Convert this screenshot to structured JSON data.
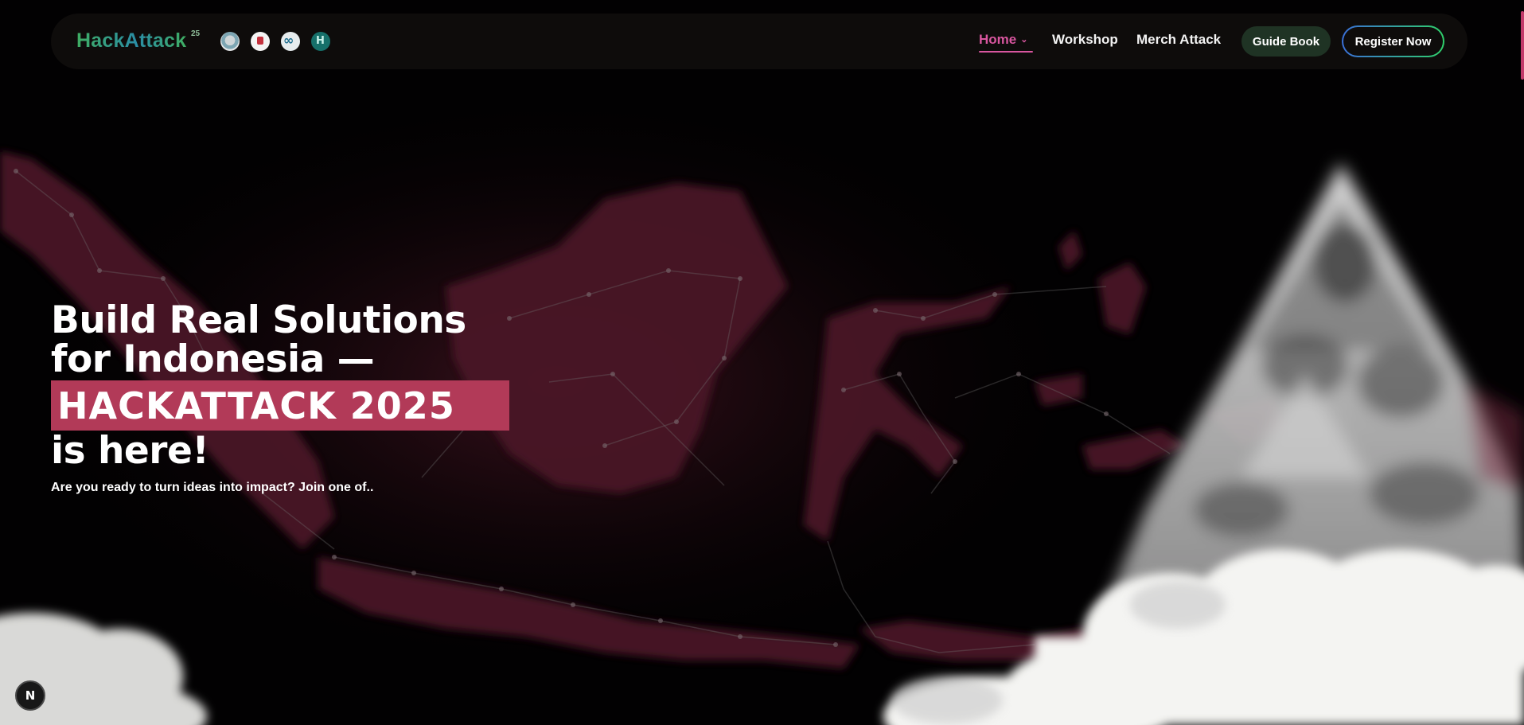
{
  "navbar": {
    "brand": "HackAttack",
    "brand_sup": "25",
    "partner_logos": [
      "partner-logo-1",
      "partner-logo-2",
      "partner-logo-3",
      "partner-logo-4"
    ],
    "links": [
      {
        "label": "Home",
        "active": true,
        "has_dropdown": true
      },
      {
        "label": "Workshop",
        "active": false
      },
      {
        "label": "Merch Attack",
        "active": false
      }
    ],
    "guide_button": "Guide Book",
    "register_button": "Register Now"
  },
  "hero": {
    "headline_line1": "Build Real Solutions",
    "headline_line2": "for Indonesia —",
    "headline_highlight": "HACKATTACK 2025",
    "headline_line3": "is here!",
    "subtitle": "Are you ready to turn ideas into impact? Join one of.."
  },
  "badge": {
    "label": "N"
  },
  "colors": {
    "accent_pink": "#d8569f",
    "highlight": "#b23a58",
    "map_tint": "#4a1725",
    "brand_green": "#3fae63",
    "brand_teal": "#2a8da5",
    "guide_button_bg": "#1f3324"
  },
  "icons": {
    "home_dropdown": "chevron-down-icon"
  }
}
